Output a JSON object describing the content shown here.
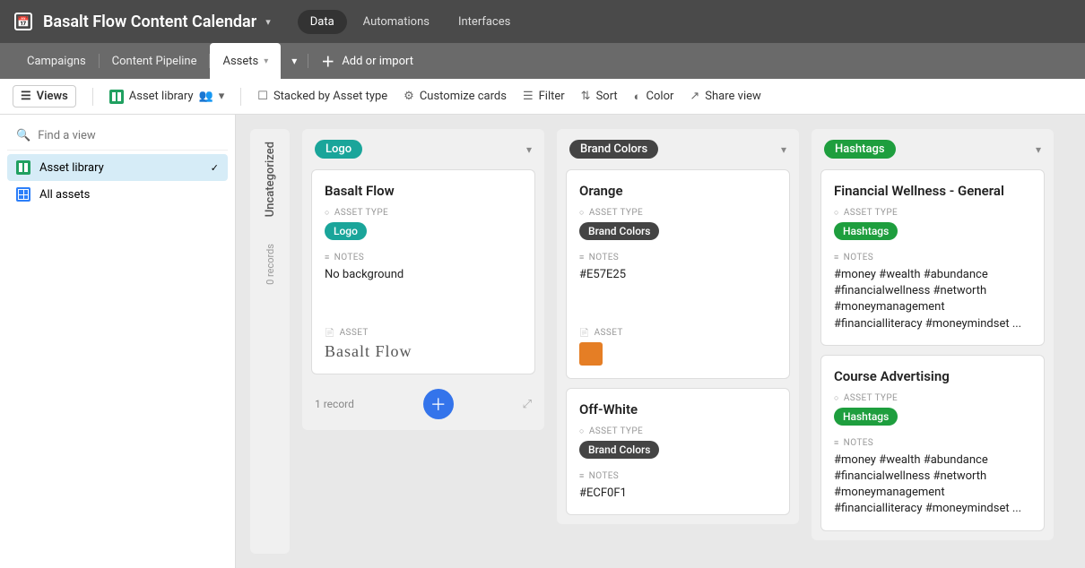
{
  "header": {
    "title": "Basalt Flow Content Calendar",
    "nav": {
      "data": "Data",
      "automations": "Automations",
      "interfaces": "Interfaces"
    }
  },
  "tabs": {
    "campaigns": "Campaigns",
    "pipeline": "Content Pipeline",
    "assets": "Assets",
    "add_import": "Add or import"
  },
  "toolbar": {
    "views": "Views",
    "asset_library": "Asset library",
    "stacked": "Stacked by Asset type",
    "customize": "Customize cards",
    "filter": "Filter",
    "sort": "Sort",
    "color": "Color",
    "share": "Share view"
  },
  "sidebar": {
    "search_placeholder": "Find a view",
    "views": {
      "asset_library": "Asset library",
      "all_assets": "All assets"
    }
  },
  "labels": {
    "asset_type": "ASSET TYPE",
    "notes": "NOTES",
    "asset": "ASSET"
  },
  "columns": {
    "uncategorized": {
      "label": "Uncategorized",
      "count": "0 records"
    },
    "logo": {
      "tag": "Logo",
      "footer_count": "1 record",
      "cards": [
        {
          "title": "Basalt Flow",
          "type_tag": "Logo",
          "notes": "No background",
          "asset_text": "Basalt Flow"
        }
      ]
    },
    "brand": {
      "tag": "Brand Colors",
      "cards": [
        {
          "title": "Orange",
          "type_tag": "Brand Colors",
          "notes": "#E57E25"
        },
        {
          "title": "Off-White",
          "type_tag": "Brand Colors",
          "notes": "#ECF0F1"
        }
      ]
    },
    "hashtags": {
      "tag": "Hashtags",
      "cards": [
        {
          "title": "Financial Wellness - General",
          "type_tag": "Hashtags",
          "notes": "#money #wealth #abundance #financialwellness #networth #moneymanagement #financialliteracy #moneymindset ..."
        },
        {
          "title": "Course Advertising",
          "type_tag": "Hashtags",
          "notes": "#money #wealth #abundance #financialwellness #networth #moneymanagement #financialliteracy #moneymindset ..."
        }
      ]
    }
  }
}
